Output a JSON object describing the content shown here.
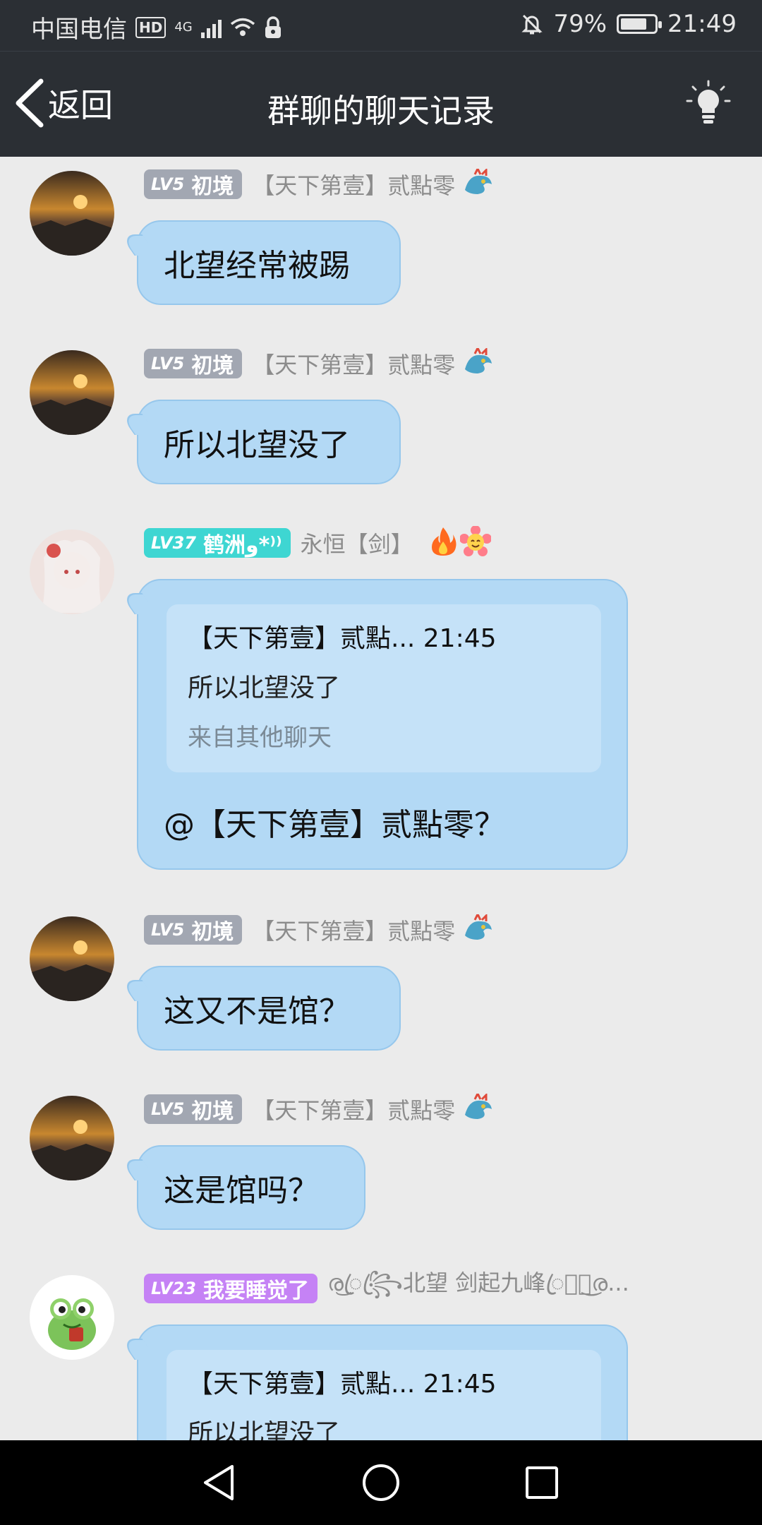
{
  "status_bar": {
    "carrier": "中国电信",
    "hd": "HD",
    "network": "4G",
    "battery_text": "79%",
    "battery_level": 0.79,
    "time": "21:49"
  },
  "header": {
    "back_label": "返回",
    "title": "群聊的聊天记录"
  },
  "messages": [
    {
      "level": "LV5",
      "title": "初境",
      "nick": "【天下第壹】贰點零",
      "text": "北望经常被踢"
    },
    {
      "level": "LV5",
      "title": "初境",
      "nick": "【天下第壹】贰點零",
      "text": "所以北望没了"
    },
    {
      "level": "LV37",
      "title": "鹤洲ﻭ*⁾⁾",
      "nick": "永恒【剑】",
      "quote": {
        "header": "【天下第壹】贰點... 21:45",
        "text": "所以北望没了",
        "source": "来自其他聊天"
      },
      "text": "@【天下第壹】贰點零？"
    },
    {
      "level": "LV5",
      "title": "初境",
      "nick": "【天下第壹】贰點零",
      "text": "这又不是馆？"
    },
    {
      "level": "LV5",
      "title": "初境",
      "nick": "【天下第壹】贰點零",
      "text": "这是馆吗？"
    },
    {
      "level": "LV23",
      "title": "我要睡觉了",
      "nick": "ര͜ꦿ꧂ꦿ北望 剑起九峰ꦿ꧂ꦿ͜ര...",
      "quote": {
        "header": "【天下第壹】贰點... 21:45",
        "text": "所以北望没了"
      }
    }
  ],
  "colors": {
    "header_bg": "#2b2f34",
    "chat_bg": "#ebebeb",
    "bubble_bg": "#b3d9f5",
    "badge_gray": "#a2a7b2",
    "badge_teal": "#3ed6d2",
    "badge_purple": "#c582f5"
  },
  "icons": {
    "back": "chevron-left-icon",
    "header_right": "lightbulb-icon",
    "nav": [
      "back-triangle-icon",
      "home-circle-icon",
      "recents-square-icon"
    ]
  }
}
